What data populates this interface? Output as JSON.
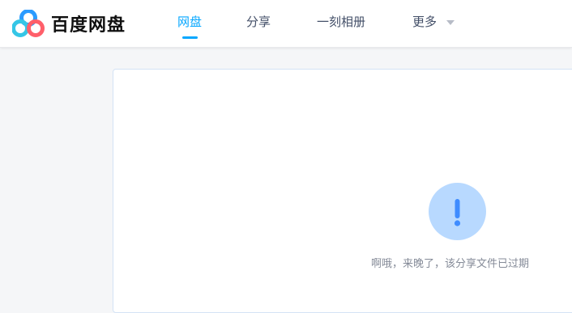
{
  "header": {
    "logo_text": "百度网盘",
    "nav": [
      {
        "label": "网盘",
        "active": true
      },
      {
        "label": "分享",
        "active": false
      },
      {
        "label": "一刻相册",
        "active": false
      },
      {
        "label": "更多",
        "active": false
      }
    ]
  },
  "main": {
    "message": "啊哦，来晚了，该分享文件已过期",
    "icon": "exclamation-icon"
  },
  "colors": {
    "accent": "#06a7ff",
    "nav_text": "#424e67",
    "message_text": "#858b98",
    "alert_circle_bg": "#b8d9ff",
    "alert_mark": "#3f8cff"
  }
}
